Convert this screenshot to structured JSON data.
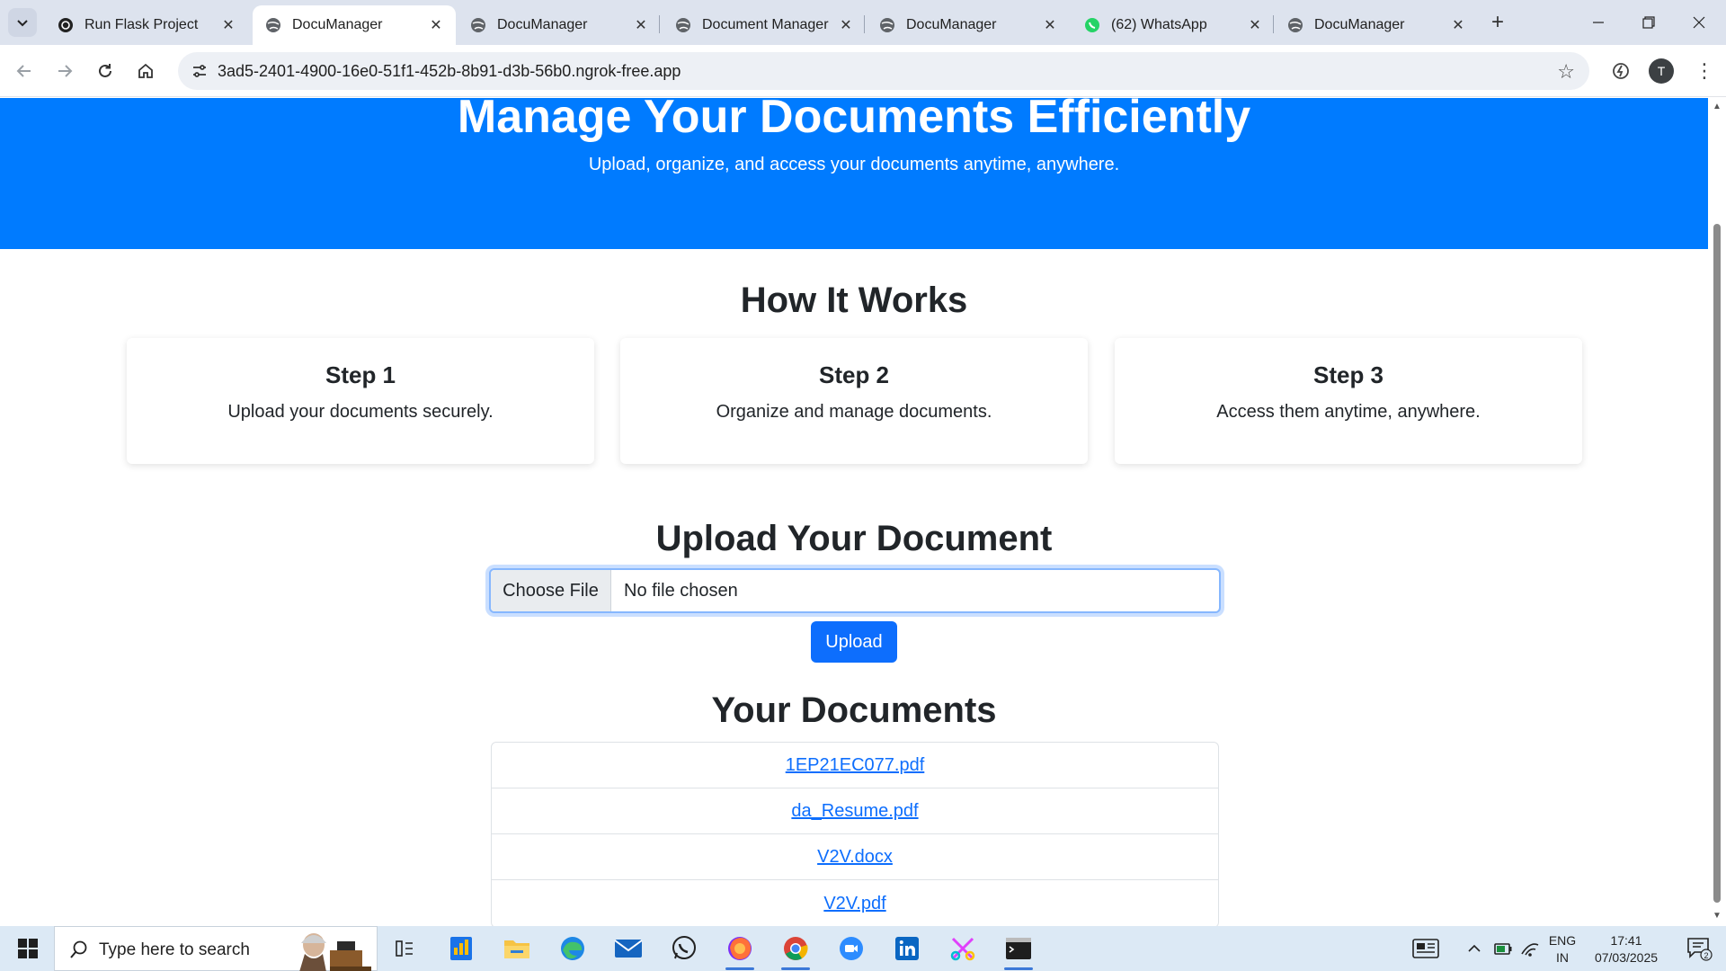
{
  "browser": {
    "tabs": [
      {
        "title": "Run Flask Project",
        "favicon": "chatgpt-icon",
        "active": false
      },
      {
        "title": "DocuManager",
        "favicon": "globe-icon",
        "active": true
      },
      {
        "title": "DocuManager",
        "favicon": "globe-icon",
        "active": false
      },
      {
        "title": "Document Manager",
        "favicon": "globe-icon",
        "active": false
      },
      {
        "title": "DocuManager",
        "favicon": "globe-icon",
        "active": false
      },
      {
        "title": "(62) WhatsApp",
        "favicon": "whatsapp-icon",
        "active": false
      },
      {
        "title": "DocuManager",
        "favicon": "globe-icon",
        "active": false
      }
    ],
    "url": "3ad5-2401-4900-16e0-51f1-452b-8b91-d3b-56b0.ngrok-free.app",
    "profile_initial": "T"
  },
  "page": {
    "hero": {
      "title": "Manage Your Documents Efficiently",
      "subtitle": "Upload, organize, and access your documents anytime, anywhere.",
      "color": "#007bff"
    },
    "how_it_works": {
      "title": "How It Works",
      "steps": [
        {
          "title": "Step 1",
          "text": "Upload your documents securely."
        },
        {
          "title": "Step 2",
          "text": "Organize and manage documents."
        },
        {
          "title": "Step 3",
          "text": "Access them anytime, anywhere."
        }
      ]
    },
    "upload": {
      "title": "Upload Your Document",
      "choose_label": "Choose File",
      "file_status": "No file chosen",
      "button_label": "Upload",
      "button_color": "#0d6efd"
    },
    "documents": {
      "title": "Your Documents",
      "items": [
        "1EP21EC077.pdf",
        "da_Resume.pdf",
        "V2V.docx",
        "V2V.pdf"
      ]
    }
  },
  "taskbar": {
    "search_placeholder": "Type here to search",
    "apps": [
      "task-view-icon",
      "files-icon",
      "file-explorer-icon",
      "edge-icon",
      "mail-icon",
      "whatsapp-icon",
      "firefox-icon",
      "chrome-icon",
      "zoom-icon",
      "linkedin-icon",
      "snip-icon",
      "terminal-icon"
    ],
    "language_line1": "ENG",
    "language_line2": "IN",
    "time": "17:41",
    "date": "07/03/2025",
    "notification_count": "2"
  }
}
